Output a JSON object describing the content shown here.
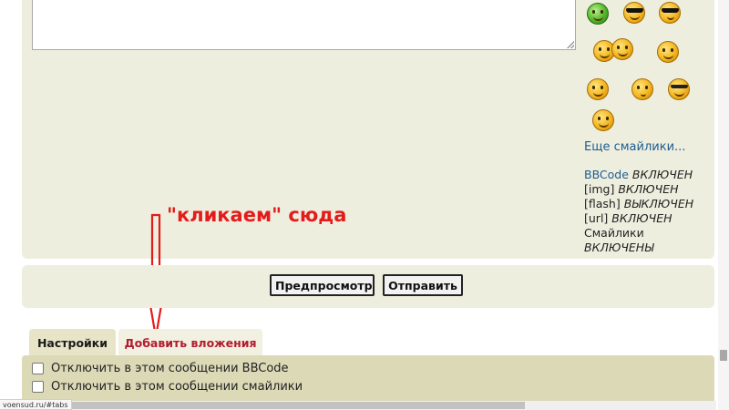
{
  "smilies": {
    "more_link": "Еще смайлики..."
  },
  "bbcode_status": {
    "bbcode_label": "BBCode",
    "bbcode_value": "ВКЛЮЧЕН",
    "img_label": "[img]",
    "img_value": "ВКЛЮЧЕН",
    "flash_label": "[flash]",
    "flash_value": "ВЫКЛЮЧЕН",
    "url_label": "[url]",
    "url_value": "ВКЛЮЧЕН",
    "smilies_label": "Смайлики",
    "smilies_value": "ВКЛЮЧЕНЫ"
  },
  "annotation": {
    "text": "\"кликаем\" сюда",
    "color": "#e31b1b"
  },
  "buttons": {
    "preview": "Предпросмотр",
    "submit": "Отправить"
  },
  "tabs": [
    {
      "label": "Настройки",
      "active": true
    },
    {
      "label": "Добавить вложения",
      "active": false
    }
  ],
  "options": [
    {
      "label": "Отключить в этом сообщении BBCode",
      "checked": false
    },
    {
      "label": "Отключить в этом сообщении смайлики",
      "checked": false
    }
  ],
  "status_bar": {
    "url": "voensud.ru/#tabs"
  }
}
